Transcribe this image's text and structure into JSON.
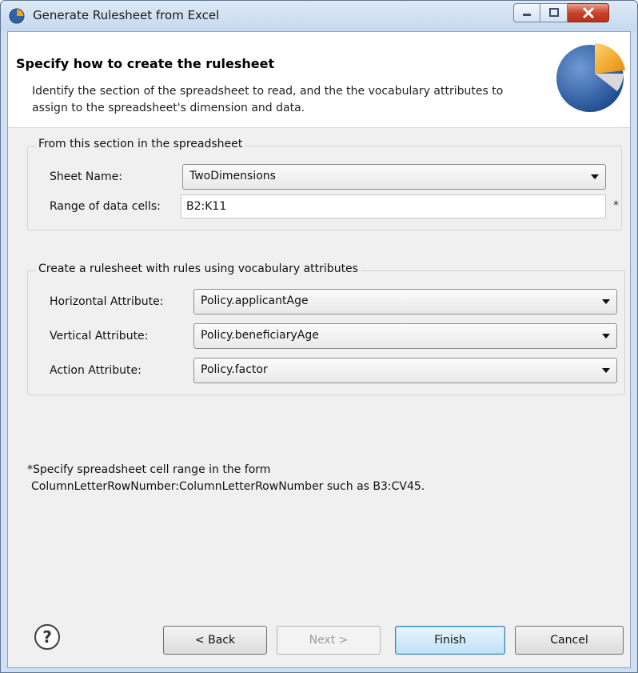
{
  "window": {
    "title": "Generate Rulesheet from Excel"
  },
  "banner": {
    "title": "Specify how to create the rulesheet",
    "description": "Identify the section of the spreadsheet to read, and the the vocabulary attributes to assign to the spreadsheet's dimension and data."
  },
  "source_section": {
    "legend": "From this section in the spreadsheet",
    "sheet_name_label": "Sheet Name:",
    "sheet_name_value": "TwoDimensions",
    "range_label": "Range of data cells:",
    "range_value": "B2:K11",
    "required_marker": "*"
  },
  "attributes_section": {
    "legend": "Create a rulesheet with rules using vocabulary attributes",
    "horizontal_label": "Horizontal Attribute:",
    "horizontal_value": "Policy.applicantAge",
    "vertical_label": "Vertical Attribute:",
    "vertical_value": "Policy.beneficiaryAge",
    "action_label": "Action Attribute:",
    "action_value": "Policy.factor"
  },
  "note": {
    "line1": "*Specify spreadsheet cell range in the form",
    "line2": "ColumnLetterRowNumber:ColumnLetterRowNumber such as B3:CV45."
  },
  "buttons": {
    "help": "?",
    "back": "< Back",
    "next": "Next >",
    "finish": "Finish",
    "cancel": "Cancel"
  },
  "colors": {
    "titlebar": "#c6d9ef",
    "close_button": "#c9432c",
    "default_button": "#bfe2f7",
    "graphic_blue": "#2f63a8",
    "graphic_orange": "#f2a515"
  },
  "icons": {
    "app": "rulesheet-app-icon",
    "banner": "pie-graphic-icon",
    "minimize": "minimize-icon",
    "maximize": "maximize-icon",
    "close": "close-icon",
    "dropdown": "chevron-down-icon",
    "help": "help-icon"
  }
}
